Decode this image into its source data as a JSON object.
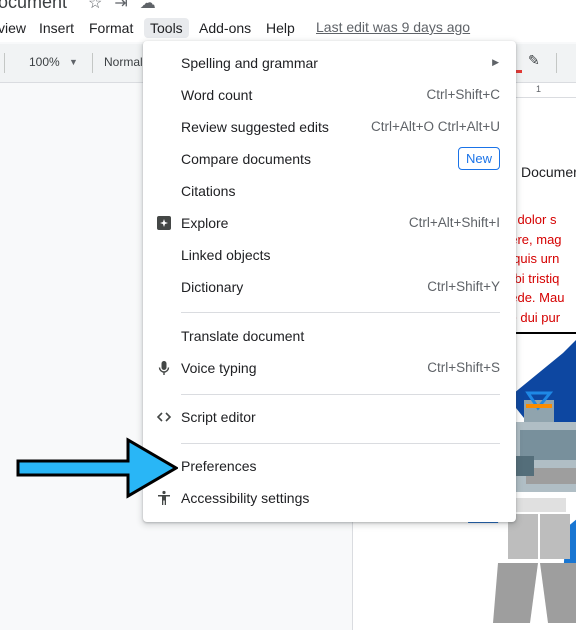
{
  "document": {
    "title": "ocument",
    "heading": "Documer",
    "red_lines": [
      "m dolor s",
      "uere, mag",
      "s quis urn",
      "orbi tristiq",
      "pede. Mau",
      "se dui pur"
    ]
  },
  "menubar": {
    "items": [
      "view",
      "Insert",
      "Format",
      "Tools",
      "Add-ons",
      "Help"
    ],
    "last_edit": "Last edit was 9 days ago"
  },
  "toolbar": {
    "zoom": "100%",
    "style": "Normal"
  },
  "ruler": {
    "mark": "1"
  },
  "tools_menu": [
    {
      "label": "Spelling and grammar",
      "submenu": true
    },
    {
      "label": "Word count",
      "shortcut": "Ctrl+Shift+C"
    },
    {
      "label": "Review suggested edits",
      "shortcut": "Ctrl+Alt+O Ctrl+Alt+U"
    },
    {
      "label": "Compare documents",
      "badge": "New"
    },
    {
      "label": "Citations"
    },
    {
      "label": "Explore",
      "shortcut": "Ctrl+Alt+Shift+I",
      "icon": "explore-icon"
    },
    {
      "label": "Linked objects"
    },
    {
      "label": "Dictionary",
      "shortcut": "Ctrl+Shift+Y"
    },
    {
      "label": "Translate document"
    },
    {
      "label": "Voice typing",
      "shortcut": "Ctrl+Shift+S",
      "icon": "microphone-icon"
    },
    {
      "label": "Script editor",
      "icon": "code-icon"
    },
    {
      "label": "Preferences"
    },
    {
      "label": "Accessibility settings",
      "icon": "accessibility-icon"
    }
  ],
  "colors": {
    "accent": "#1a73e8",
    "arrow": "#29b6f6",
    "doc_red": "#d50000"
  }
}
